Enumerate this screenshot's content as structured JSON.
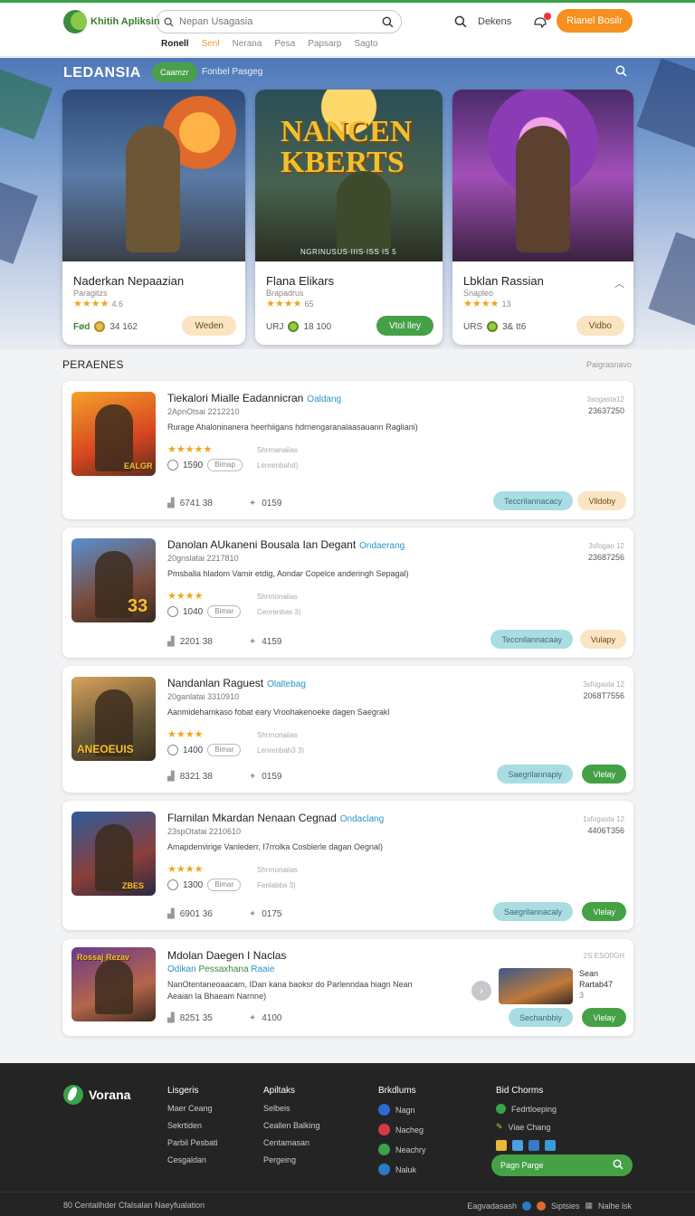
{
  "header": {
    "logo_text": "Khitih Apliksin",
    "search_placeholder": "Nepan Usagasia",
    "login_label": "Dekens",
    "cta_label": "Rianel Bosilr",
    "nav": [
      "Ronell",
      "Senl",
      "Nerana",
      "Pesa",
      "Papsarp",
      "Sagto"
    ]
  },
  "hero": {
    "title": "LEDANSIA",
    "tab_active": "Caamzr",
    "tab_other": "Fonbel Pasgeg",
    "cards": [
      {
        "title": "Naderkan Nepaazian",
        "sub": "Paragitzs",
        "stars": "★★★★",
        "rating": "4.6",
        "meta_label": "Fød",
        "meta_value": "34 162",
        "button": "Weden",
        "button_style": "peach"
      },
      {
        "title": "Flana Elikars",
        "sub": "Brapadrus",
        "stars": "★★★★",
        "rating": "65",
        "meta_label": "URJ",
        "meta_value": "18 100",
        "button": "Vtol lley",
        "button_style": "green",
        "art_title": "NANCEN KBERTS",
        "art_sub": "NGRINUSUS·IIIS·ISS IS 5"
      },
      {
        "title": "Lbklan Rassian",
        "sub": "Snapleo",
        "stars": "★★★★",
        "rating": "13",
        "meta_label": "URS",
        "meta_value": "3& tt6",
        "button": "Vidbo",
        "button_style": "peach"
      }
    ]
  },
  "list": {
    "title": "PERAENES",
    "link": "Paigrasnavo",
    "items": [
      {
        "title": "Tiekalori Mialle Eadannicran",
        "badge": "Oaldang",
        "date": "2ApnOtsai 2212210",
        "desc": "Rurage Ahaloninanera heerhiigans hdrnengaranalaasauann Ragliani)",
        "stars": "★★★★★",
        "small1": "Shrrnanaiias",
        "clock": "1590",
        "pill": "Bimap",
        "small2": "Lenrenbahd)",
        "rt1": "3sogasta12",
        "rt2": "23637250",
        "likes": "6741  38",
        "shares": "0159",
        "b1": "Teccrilannacacy",
        "b2": "Vlldoby",
        "b2_style": "peach",
        "thumb_label": "EALGR"
      },
      {
        "title": "Danolan AUkaneni Bousala Ian Degant",
        "badge": "Ondaerang",
        "date": "20gnslatai 2217810",
        "desc": "Pmsballa hladom Vamir etdig, Aondar Copelce anderingh Sepagal)",
        "stars": "★★★★",
        "small1": "Shrrnonaiias",
        "clock": "1040",
        "pill": "Bimar",
        "small2": "Cenrenbas 3)",
        "rt1": "3sfogao 12",
        "rt2": "23687256",
        "likes": "2201  38",
        "shares": "4159",
        "b1": "Teccnilannacaay",
        "b2": "Vulapy",
        "b2_style": "peach",
        "thumb_label": "33"
      },
      {
        "title": "Nandanlan Raguest",
        "badge": "Olaltebag",
        "date": "20ganlatai 3310910",
        "desc": "Aanmidehamkaso fobat eary Vroohakenoeke dagen Saegrakl",
        "stars": "★★★★",
        "small1": "Shrrnonaiias",
        "clock": "1400",
        "pill": "Bimar",
        "small2": "Lenrenbah3 3)",
        "rt1": "3sfogasta 12",
        "rt2": "2068T7556",
        "likes": "8321  38",
        "shares": "0159",
        "b1": "Saegrilannapiy",
        "b2": "Vlelay",
        "b2_style": "green",
        "thumb_label": "ANEOEUIS"
      },
      {
        "title": "Flarnilan Mkardan Nenaan Cegnad",
        "badge": "Ondaclang",
        "date": "23spOtatai 2210610",
        "desc": "Amapdenvirige Vanlederr, I7rrolka Cosblerle dagan Oegnal)",
        "stars": "★★★★",
        "small1": "Shrrnonaiias",
        "clock": "1300",
        "pill": "Bimar",
        "small2": "Fenlabba 3)",
        "rt1": "1sfogasta 12",
        "rt2": "4406T356",
        "likes": "6901  36",
        "shares": "0175",
        "b1": "Saegrilannacaly",
        "b2": "Vlelay",
        "b2_style": "green",
        "thumb_label": "ZBES"
      },
      {
        "title": "Mdolan Daegen I Naclas",
        "badge1": "Odikan",
        "badge2": "Pessaxhana",
        "badge3": "Raaie",
        "desc": "NanOtentaneoaacam, IDan kana baoksr do Parlenndaa hiagn Nean Aeaian Ia Bhaeam Narnne)",
        "rt1": "2S ESO0GH",
        "mini_title": "Sean",
        "mini_sub": "Rartab47",
        "mini_num": "3",
        "likes": "8251  35",
        "shares": "4100",
        "b1": "Sechanbbiy",
        "b2": "Vlelay",
        "b2_style": "green",
        "thumb_label": "Rossaj Rezav"
      }
    ]
  },
  "footer": {
    "logo": "Vorana",
    "col1": {
      "title": "Lisgeris",
      "items": [
        "Maer Ceang",
        "Sekrtiden",
        "Parbil Pesbati",
        "Cesgaldan"
      ]
    },
    "col2": {
      "title": "Apiltaks",
      "items": [
        "Selbeis",
        "Ceallen Balking",
        "Centamasan",
        "Pergeing"
      ]
    },
    "col3": {
      "title": "Brkdlums",
      "items": [
        "Nagn",
        "Nacheg",
        "Neachry",
        "Naluk"
      ]
    },
    "col4": {
      "title": "Bid Chorms",
      "items": [
        "Fedrtloeping",
        "Viae Chang"
      ]
    },
    "search_label": "Pagn Parge",
    "copyright": "80 Centailhder Cfalsalan Naeyfualation",
    "bottom_right": [
      "Eagvadasash",
      "Siptsies",
      "Nalhe lsk"
    ]
  },
  "colors": {
    "accent_green": "#45a146",
    "accent_orange": "#f6901e",
    "badge_blue": "#2a94c8"
  }
}
